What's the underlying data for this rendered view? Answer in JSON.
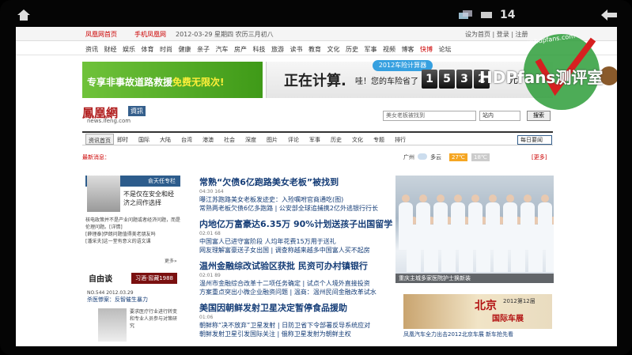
{
  "statusbar": {
    "time": "14"
  },
  "topbar": {
    "left": "凤凰网首页",
    "mobile": "手机凤凰网",
    "date": "2012-03-29 星期四 农历三月初八",
    "right": "设为首页 | 登录 | 注册"
  },
  "nav": [
    "资讯",
    "财经",
    "娱乐",
    "体育",
    "时尚",
    "健康",
    "亲子",
    "汽车",
    "房产",
    "科技",
    "旅游",
    "读书",
    "教育",
    "文化",
    "历史",
    "军事",
    "视频",
    "博客",
    "快博",
    "论坛"
  ],
  "banner": {
    "left_a": "专享非事故道路救援",
    "left_b": "免费无限次!",
    "badge": "2012车险计算器",
    "calc": "正在计算.",
    "save": "哇！您的车险省了",
    "digits": [
      "1",
      "5",
      "3",
      "2"
    ],
    "unit": "元"
  },
  "brand": {
    "logo": "鳳凰網",
    "tag": "資訊",
    "url": "news.ifeng.com",
    "search_placeholder": "美女老板被找到",
    "site": "站内",
    "search_btn": "搜索"
  },
  "tabs": [
    "资讯首页",
    "即时",
    "国际",
    "大陆",
    "台湾",
    "港澳",
    "社会",
    "深度",
    "图片",
    "评论",
    "军事",
    "历史",
    "文化",
    "专题",
    "排行"
  ],
  "daily": "每日要闻",
  "newsrow": {
    "label": "最新消息：",
    "city": "广州",
    "weather": "多云",
    "t1": "27℃",
    "t2": "18℃",
    "more": "[更多]"
  },
  "left": {
    "column_head": "俞天任专栏",
    "column_title": "不是仅在安全和经济之间作选择",
    "list": [
      "核电政策并不是产业问题或者经济问题，而是伦理问题。[详情]",
      "[薛理泰]伊朗问题值得美老朋友吗",
      "[潘采夫]这一堂有意义的语文课"
    ],
    "more": "更多»",
    "ziyou": "自由谈",
    "ziyou_tag": "习酒·窖藏1988",
    "issue": "NO.544 2012.03.29",
    "issue_title": "杀医惨案：反智催生暴力",
    "person_txt": "要求医疗行业进行转变和专业人员参与对策研究"
  },
  "middle": [
    {
      "head": "常熟“欠债6亿跑路美女老板”被找到",
      "meta": "04:30 164",
      "subs": [
        "曝江苏跑路美女老板发迹史：入殓嘱咐官商通吃(图)",
        "常熟两老板欠债6亿多跑路 | 公安部全球追捕携2亿外逃银行行长"
      ]
    },
    {
      "head": "内地亿万富豪达6.35万 90%计划送孩子出国留学",
      "meta": "02:01 68",
      "subs": [
        "中国富人已进守富阶段 人均年花费15万用于送礼",
        "网友理解富豪送子女出国 | 调查称越来越多中国富人买不起房"
      ]
    },
    {
      "head": "温州金融综改试验区获批 民资可办村镇银行",
      "meta": "02:01 89",
      "subs": [
        "温州市金融综合改革十二项任务确定 | 试点个人境外直接投资",
        "方案重点突出小微企业融资问题 | 温商：温州民间金融改革试水"
      ]
    },
    {
      "head": "美国因朝鲜发射卫星决定暂停食品援助",
      "meta": "01:06",
      "subs": [
        "朝鲜称“决不放弃”卫星发射 | 日防卫省下令部署反导系统应对",
        "朝鲜发射卫星引发国际关注 | 俄称卫星发射为朝鲜主权"
      ]
    }
  ],
  "right": {
    "caption1": "重庆主城多家医院护士换新装",
    "p2_title": "北京",
    "p2_year": "2012第12届",
    "p2_sub": "国际车展",
    "caption2": "凤凰汽车全力出击2012北京车展 新车抢先看"
  },
  "watermark": {
    "url": "www.hdpfans.com",
    "title": "HDPfans测评室"
  }
}
